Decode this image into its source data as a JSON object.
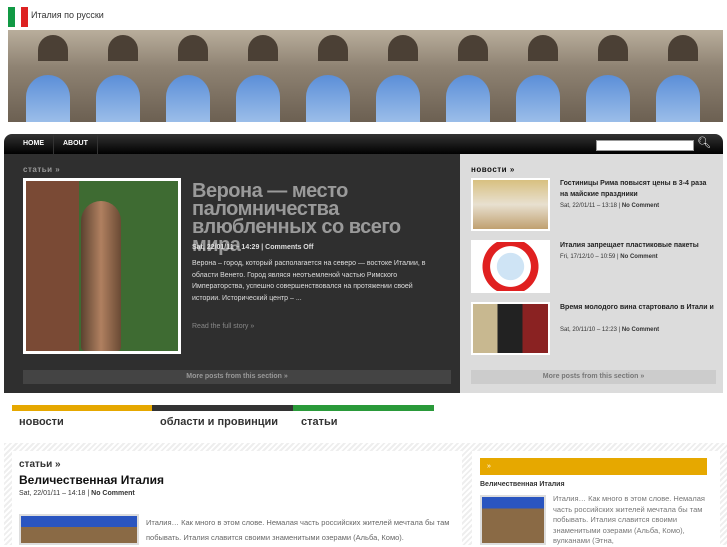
{
  "site": {
    "title": "Италия по русски"
  },
  "nav": {
    "items": [
      "HOME",
      "ABOUT"
    ],
    "search_placeholder": ""
  },
  "featured": {
    "section": "статьи »",
    "title": "Верона — место паломничества влюбленных со всего мира",
    "meta": "Sat, 22/01/11 – 14:29 | Comments Off",
    "excerpt": "Верона – город, который располагается на северо — востоке Италии, в области Венето. Город являся неотъемленой частью Римского Императорства, успешно совершенствовался на протяжении своей истории. Исторический центр – ...",
    "read_more": "Read the full story »",
    "more_posts": "More posts from this section »"
  },
  "news": {
    "section": "новости »",
    "items": [
      {
        "title": "Гостиницы Рима повысят цены в 3-4 раза на майские праздники",
        "date": "Sat, 22/01/11 – 13:18",
        "comments": "No Comment"
      },
      {
        "title": "Италия запрещает пластиковые пакеты",
        "date": "Fri, 17/12/10 – 10:59",
        "comments": "No Comment"
      },
      {
        "title": "Время молодого вина стартовало в Итали и",
        "date": "Sat, 20/11/10 – 12:23",
        "comments": "No Comment"
      }
    ],
    "more_posts": "More posts from this section »"
  },
  "categories": [
    {
      "label": "новости",
      "color": "#e6a800"
    },
    {
      "label": "области и провинции",
      "color": "#333333"
    },
    {
      "label": "статьи",
      "color": "#2a9a3a"
    }
  ],
  "article": {
    "section": "статьи »",
    "title": "Величественная Италия",
    "date": "Sat, 22/01/11 – 14:18",
    "comments": "No Comment",
    "excerpt": "Италия… Как много в этом слове. Немалая часть российских жителей мечтала бы там побывать. Италия славится своими знаменитыми озерами (Альба, Комо)."
  },
  "sidebar_widget": {
    "header": "»",
    "title": "Величественная Италия",
    "excerpt": "Италия… Как много в этом слове. Немалая часть российских жителей мечтала бы там побывать. Италия славится своими знаменитыми озерами (Альба, Комо), вулканами (Этна,"
  }
}
